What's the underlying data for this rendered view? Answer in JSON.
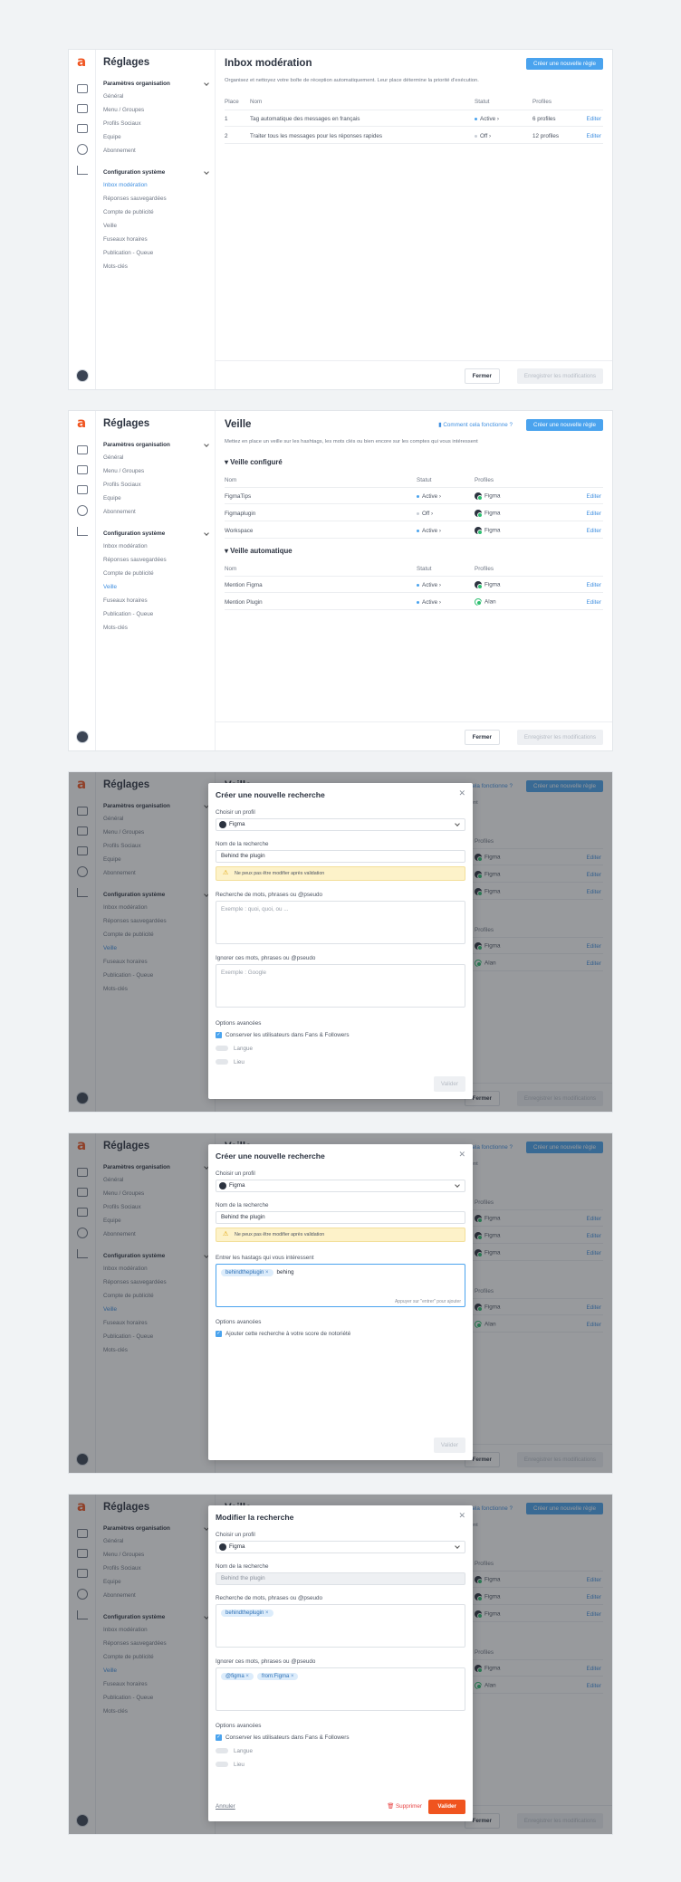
{
  "sidebar": {
    "title": "Réglages",
    "group1": "Paramètres organisation",
    "group1_items": [
      "Général",
      "Menu / Groupes",
      "Profils Sociaux",
      "Equipe",
      "Abonnement"
    ],
    "group2": "Configuration système",
    "group2_items": [
      "Inbox modération",
      "Réponses sauvegardées",
      "Compte de publicité",
      "Veille",
      "Fuseaux horaires",
      "Publication - Queue",
      "Mots-clés"
    ]
  },
  "inbox": {
    "title": "Inbox modération",
    "desc": "Organisez et nettoyez votre boîte de réception automatiquement. Leur place détermine la priorité d'exécution.",
    "create_button": "Créer une nouvelle règle",
    "headers": [
      "Place",
      "Nom",
      "Statut",
      "Profiles"
    ],
    "rows": [
      {
        "place": "1",
        "name": "Tag automatique des messages en français",
        "status": "Active",
        "profiles": "6 profiles",
        "edit": "Editer"
      },
      {
        "place": "2",
        "name": "Traiter tous les messages pour les réponses rapides",
        "status": "Off",
        "profiles": "12 profiles",
        "edit": "Editer"
      }
    ]
  },
  "veille": {
    "title": "Veille",
    "desc": "Mettez en place un veille sur les hashtags, les mots clés ou bien encore sur les comptes qui vous intéressent",
    "help": "Comment cela fonctionne ?",
    "create_button": "Créer une nouvelle règle",
    "section1": "Veille configuré",
    "section2": "Veille automatique",
    "headers": [
      "Nom",
      "Statut",
      "Profiles"
    ],
    "configured": [
      {
        "name": "FigmaTips",
        "status": "Active",
        "profile": "Figma",
        "edit": "Editer"
      },
      {
        "name": "Figmaplugin",
        "status": "Off",
        "profile": "Figma",
        "edit": "Editer"
      },
      {
        "name": "Workspace",
        "status": "Active",
        "profile": "Figma",
        "edit": "Editer"
      }
    ],
    "automatic": [
      {
        "name": "Mention Figma",
        "status": "Active",
        "profile": "Figma",
        "edit": "Editer"
      },
      {
        "name": "Mention Plugin",
        "status": "Active",
        "profile": "Alan",
        "edit": "Editer"
      }
    ]
  },
  "footer": {
    "close": "Fermer",
    "save": "Enregistrer les modifications"
  },
  "modal1": {
    "title": "Créer une nouvelle recherche",
    "profile_label": "Choisir un profil",
    "profile_value": "Figma",
    "name_label": "Nom de la recherche",
    "name_value": "Behind the plugin",
    "warning": "Ne peux pas être modifier après validation",
    "search_label": "Recherche de mots, phrases ou @pseudo",
    "search_placeholder": "Exemple : quoi, quoi, ou ...",
    "ignore_label": "Ignorer ces mots, phrases ou @pseudo",
    "ignore_placeholder": "Exemple : Google",
    "options_label": "Options avancées",
    "opt_check": "Conserver les utilisateurs dans Fans & Followers",
    "opt_lang": "Langue",
    "opt_place": "Lieu",
    "validate": "Valider"
  },
  "modal2": {
    "title": "Créer une nouvelle recherche",
    "profile_label": "Choisir un profil",
    "profile_value": "Figma",
    "name_label": "Nom de la recherche",
    "name_value": "Behind the plugin",
    "warning": "Ne peux pas être modifier après validation",
    "hashtag_label": "Entrer les hastags qui vous intéressent",
    "chip": "behindtheplugin",
    "typed": "behing",
    "hint": "Appuyer sur \"entrer\" pour ajouter",
    "options_label": "Options avancées",
    "opt_check": "Ajouter cette recherche à votre score de notoriété",
    "validate": "Valider"
  },
  "modal3": {
    "title": "Modifier la recherche",
    "profile_label": "Choisir un profil",
    "profile_value": "Figma",
    "name_label": "Nom de la recherche",
    "name_value": "Behind the plugin",
    "search_label": "Recherche de mots, phrases ou @pseudo",
    "search_chip": "behindtheplugin",
    "ignore_label": "Ignorer ces mots, phrases ou @pseudo",
    "ignore_chips": [
      "@figma",
      "from:Figma"
    ],
    "options_label": "Options avancées",
    "opt_check": "Conserver les utilisateurs dans Fans & Followers",
    "opt_lang": "Langue",
    "opt_place": "Lieu",
    "cancel": "Annuler",
    "delete": "Supprimer",
    "validate": "Valider"
  }
}
